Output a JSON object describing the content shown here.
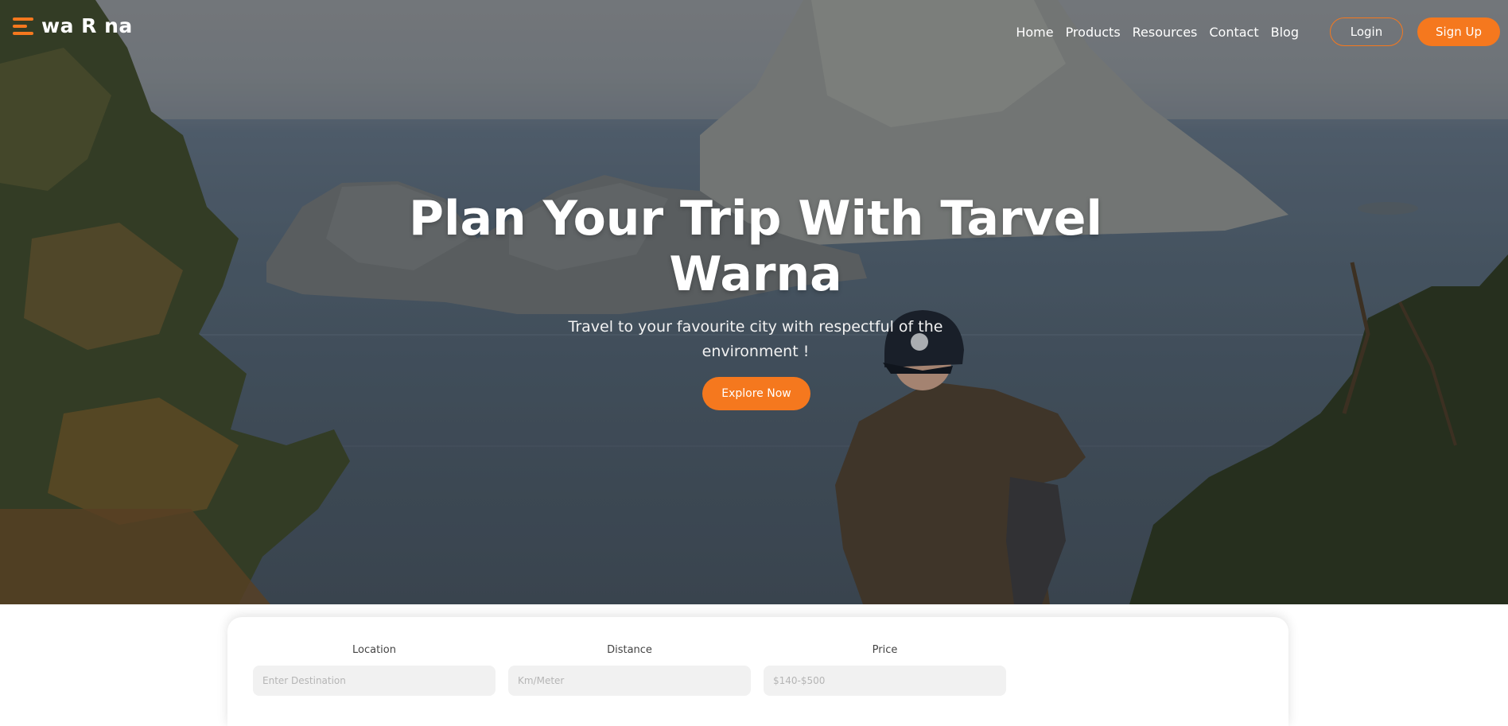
{
  "brand": {
    "name": "wa R na",
    "icon": "menu-icon",
    "accent": "#f5781e"
  },
  "nav": {
    "links": [
      "Home",
      "Products",
      "Resources",
      "Contact",
      "Blog"
    ],
    "login_label": "Login",
    "signup_label": "Sign Up"
  },
  "hero": {
    "title": "Plan Your Trip With Tarvel Warna",
    "subtitle": "Travel to your favourite city with respectful of the environment !",
    "cta_label": "Explore Now"
  },
  "search": {
    "fields": [
      {
        "label": "Location",
        "placeholder": "Enter Destination"
      },
      {
        "label": "Distance",
        "placeholder": "Km/Meter"
      },
      {
        "label": "Price",
        "placeholder": "$140-$500"
      }
    ]
  },
  "colors": {
    "accent": "#f5781e",
    "white": "#ffffff"
  }
}
